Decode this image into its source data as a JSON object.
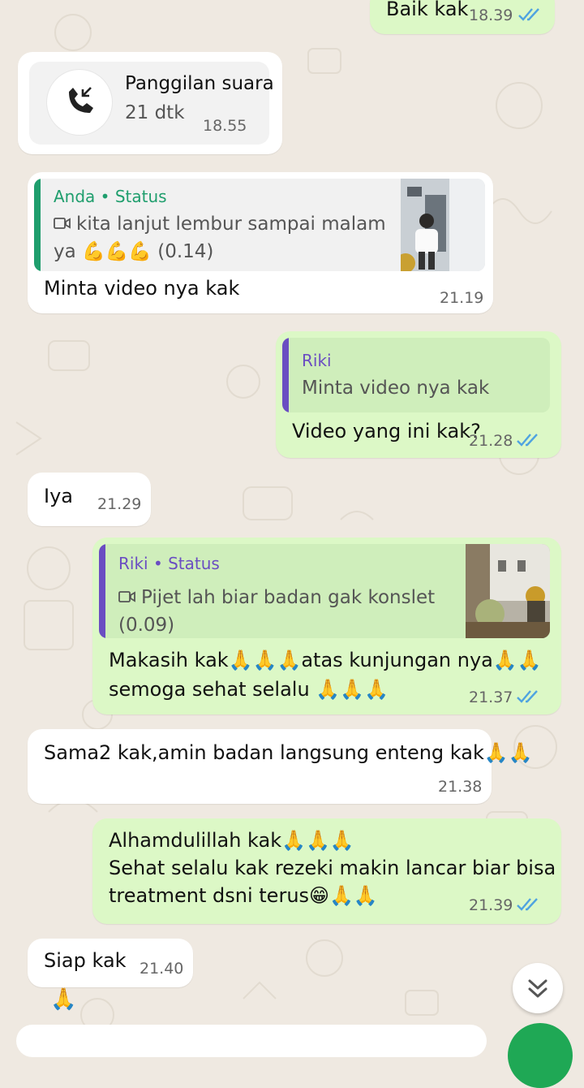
{
  "colors": {
    "wallpaper": "#efe9e1",
    "incoming": "#ffffff",
    "outgoing": "#dcf8c6",
    "tick_read": "#4fa3e0",
    "quote_own": "#1f9e6d",
    "quote_contact": "#6a4dc2"
  },
  "messages": {
    "m1": {
      "text": "Baik kak",
      "time": "18.39"
    },
    "call": {
      "title": "Panggilan suara",
      "duration": "21 dtk",
      "time": "18.55",
      "icon": "incoming-call-icon"
    },
    "m3": {
      "quote_author": "Anda • Status",
      "quote_line1": "kita lanjut lembur sampai malam",
      "quote_line2": "ya 💪💪💪 (0.14)",
      "text": "Minta video nya kak",
      "time": "21.19"
    },
    "m4": {
      "quote_author": "Riki",
      "quote_text": "Minta video nya kak",
      "text": "Video yang ini kak?",
      "time": "21.28"
    },
    "m5": {
      "text": "Iya",
      "time": "21.29"
    },
    "m6": {
      "quote_author": "Riki • Status",
      "quote_line1": "Pijet lah biar badan gak konslet",
      "quote_line2": "(0.09)",
      "line1": "Makasih kak🙏🙏🙏atas kunjungan nya🙏🙏",
      "line2": "semoga sehat selalu 🙏🙏🙏",
      "time": "21.37"
    },
    "m7": {
      "text": "Sama2 kak,amin badan langsung enteng kak🙏🙏",
      "time": "21.38"
    },
    "m8": {
      "line1": "Alhamdulillah kak🙏🙏🙏",
      "line2": "Sehat selalu kak rezeki makin lancar biar bisa",
      "line3": "treatment dsni terus😁🙏🙏",
      "time": "21.39"
    },
    "m9": {
      "text": "Siap kak",
      "time": "21.40"
    },
    "m10": {
      "text": "🙏"
    }
  },
  "scroll_button": {
    "icon": "double-chevron-down-icon"
  }
}
